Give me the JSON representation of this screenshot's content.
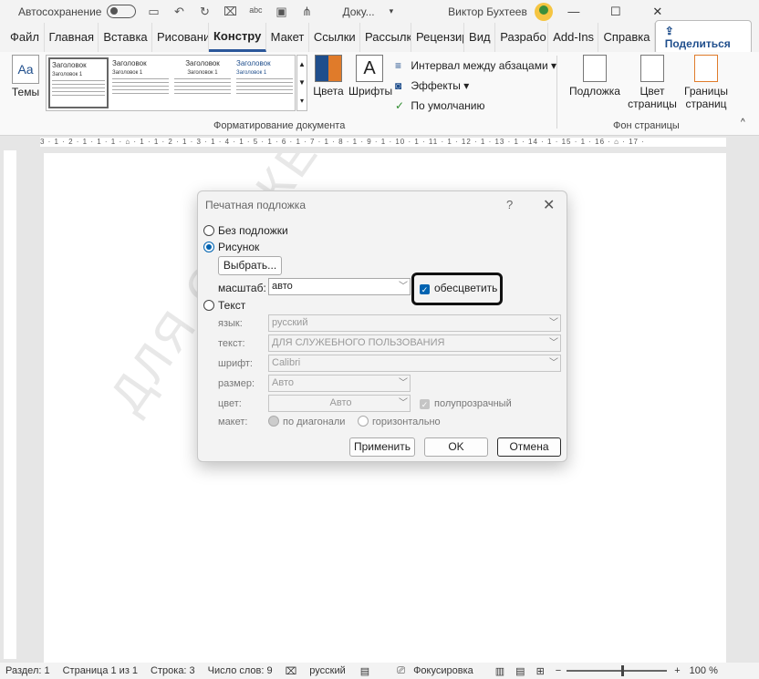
{
  "titlebar": {
    "autosave_label": "Автосохранение",
    "doc_name": "Доку...",
    "user_name": "Виктор Бухтеев",
    "icons": [
      "save-icon",
      "undo-icon",
      "redo-icon",
      "format-painter-icon",
      "spelling-icon",
      "screen-icon",
      "tree-icon"
    ]
  },
  "tabs": [
    "Файл",
    "Главная",
    "Вставка",
    "Рисовани",
    "Констру",
    "Макет",
    "Ссылки",
    "Рассылк",
    "Рецензир",
    "Вид",
    "Разрабо",
    "Add-Ins",
    "Справка"
  ],
  "active_tab": "Констру",
  "share_label": "Поделиться",
  "ribbon": {
    "themes_label": "Темы",
    "gallery": [
      {
        "title": "Заголовок",
        "sub": "Заголовок 1"
      },
      {
        "title": "Заголовок",
        "sub": "Заголовок 1"
      },
      {
        "title": "Заголовок",
        "sub": "Заголовок 1"
      },
      {
        "title": "Заголовок",
        "sub": "Заголовок 1"
      }
    ],
    "colors_label": "Цвета",
    "fonts_label": "Шрифты",
    "paragraph_spacing": "Интервал между абзацами",
    "effects": "Эффекты",
    "set_default": "По умолчанию",
    "group_doc_format": "Форматирование документа",
    "watermark_label": "Подложка",
    "page_color_label": "Цвет страницы",
    "page_borders_label": "Границы страниц",
    "group_page_bg": "Фон страницы"
  },
  "ruler": {
    "horizontal": "3 · 1 · 2 · 1 · 1 · 1 · ⌂ · 1 · 1 · 2 · 1 · 3 · 1 · 4 · 1 · 5 · 1 · 6 · 1 · 7 · 1 · 8 · 1 · 9 · 1 · 10 · 1 · 11 · 1 · 12 · 1 · 13 · 1 · 14 · 1 · 15 · 1 · 16 · ⌂ · 17 ·"
  },
  "watermark_text": "ДЛЯ СЛУЖЕБНОГО ПОЛЬЗОВАНИЯ",
  "dialog": {
    "title": "Печатная подложка",
    "help": "?",
    "close": "✕",
    "no_watermark": "Без подложки",
    "picture": "Рисунок",
    "select_btn": "Выбрать...",
    "scale_label": "масштаб:",
    "scale_value": "авто",
    "washout_label": "обесцветить",
    "text_option": "Текст",
    "language_label": "язык:",
    "language_value": "русский",
    "text_label": "текст:",
    "text_value": "ДЛЯ СЛУЖЕБНОГО ПОЛЬЗОВАНИЯ",
    "font_label": "шрифт:",
    "font_value": "Calibri",
    "size_label": "размер:",
    "size_value": "Авто",
    "color_label": "цвет:",
    "color_value": "Авто",
    "semitransparent": "полупрозрачный",
    "layout_label": "макет:",
    "diagonal": "по диагонали",
    "horizontal": "горизонтально",
    "apply": "Применить",
    "ok": "OK",
    "cancel": "Отмена"
  },
  "status": {
    "section": "Раздел: 1",
    "page": "Страница 1 из 1",
    "line": "Строка: 3",
    "words": "Число слов: 9",
    "language": "русский",
    "focus": "Фокусировка",
    "zoom": "100 %"
  }
}
